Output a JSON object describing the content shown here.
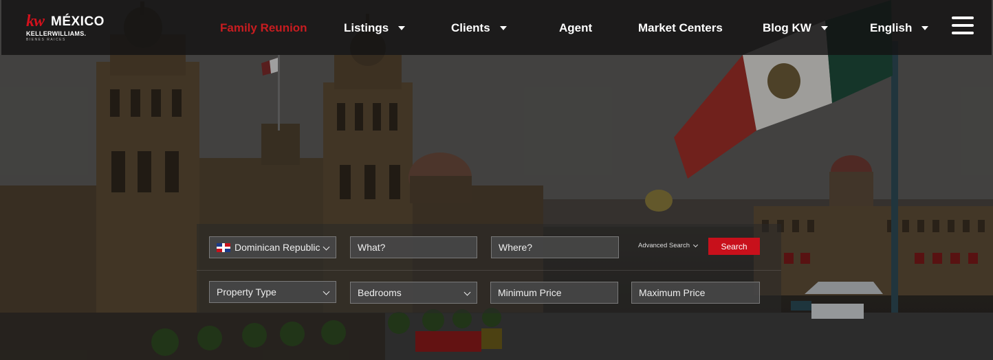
{
  "brand": {
    "kw": "kw",
    "name": "MÉXICO",
    "sub": "KELLERWILLIAMS.",
    "tag": "BIENES RAICES"
  },
  "nav": {
    "items": [
      {
        "label": "Family Reunion",
        "active": true,
        "dropdown": false
      },
      {
        "label": "Listings",
        "active": false,
        "dropdown": true
      },
      {
        "label": "Clients",
        "active": false,
        "dropdown": true
      },
      {
        "label": "Agent",
        "active": false,
        "dropdown": false
      },
      {
        "label": "Market Centers",
        "active": false,
        "dropdown": false
      },
      {
        "label": "Blog KW",
        "active": false,
        "dropdown": true
      },
      {
        "label": "English",
        "active": false,
        "dropdown": true
      }
    ],
    "menu_icon": "hamburger-icon"
  },
  "search": {
    "country": "Dominican Republic",
    "country_flag_icon": "dominican-republic-flag-icon",
    "what_placeholder": "What?",
    "where_placeholder": "Where?",
    "advanced_label": "Advanced Search",
    "search_label": "Search",
    "property_type": "Property Type",
    "bedrooms": "Bedrooms",
    "min_price_placeholder": "Minimum Price",
    "max_price_placeholder": "Maximum Price"
  },
  "colors": {
    "accent": "#c8101b",
    "active_nav": "#c81c20"
  }
}
